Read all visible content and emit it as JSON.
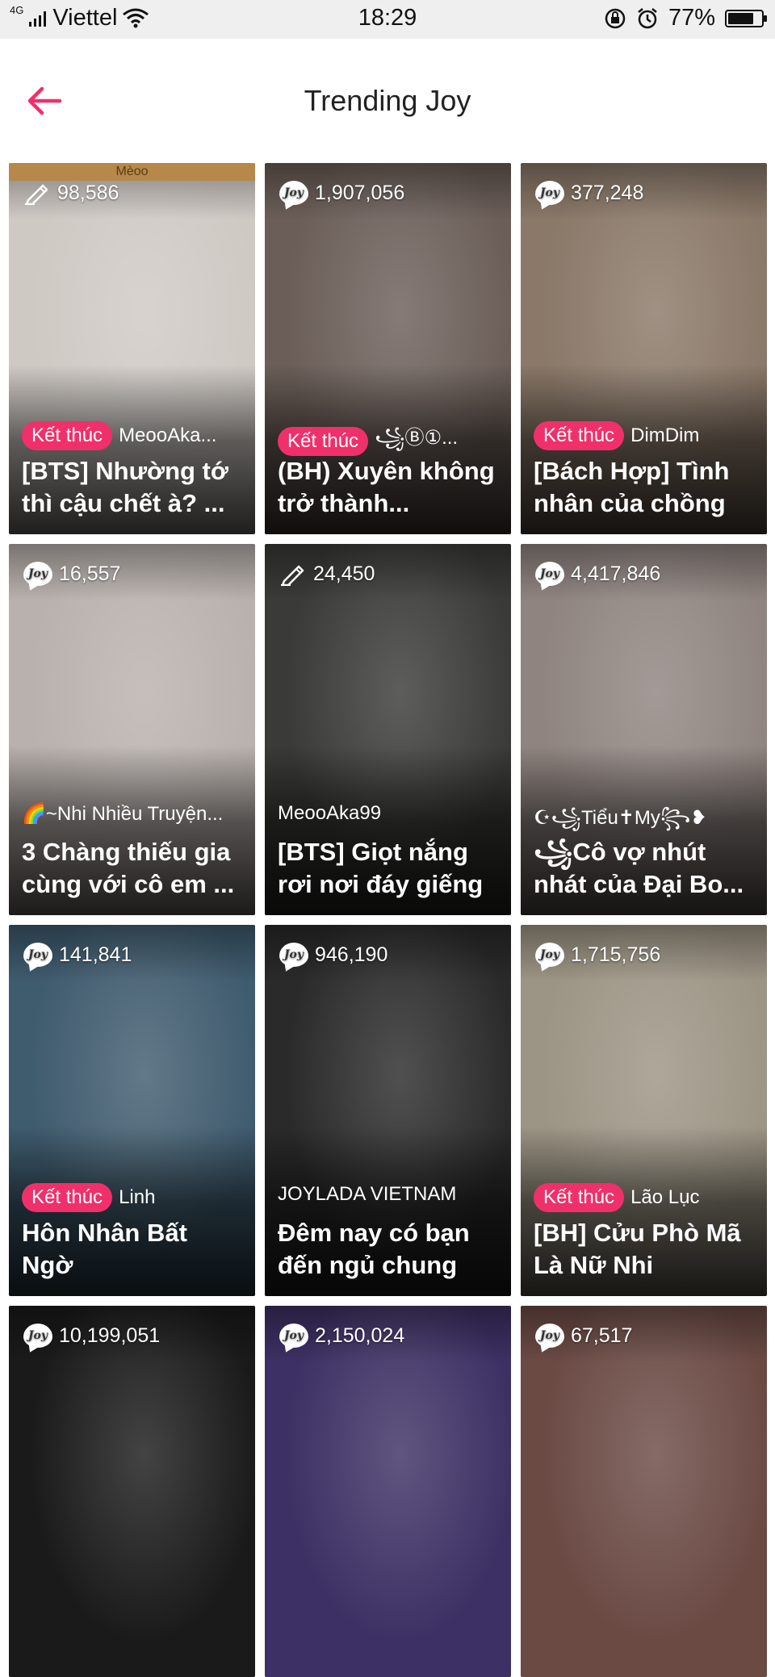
{
  "status_bar": {
    "network": "4G",
    "carrier": "Viettel",
    "time": "18:29",
    "battery": "77%",
    "battery_level": 0.77
  },
  "header": {
    "title": "Trending Joy"
  },
  "colors": {
    "accent": "#f0306a",
    "badge_bg": "#ffffff"
  },
  "cards": [
    {
      "count": "98,586",
      "icon": "pen-icon",
      "status": "Kết thúc",
      "author": "MeooAka...",
      "title": "[BTS] Nhường tớ thì cậu chết à? ...",
      "cover_text": "Mèoo",
      "cover": "#cfc9c4"
    },
    {
      "count": "1,907,056",
      "icon": "joy-icon",
      "status": "Kết thúc",
      "author": "꧁Ⓑ①...",
      "title": "(BH) Xuyên không trở thành...",
      "cover": "#6b5e58"
    },
    {
      "count": "377,248",
      "icon": "joy-icon",
      "status": "Kết thúc",
      "author": "DimDim",
      "title": "[Bách Hợp] Tình nhân của chồng",
      "cover": "#8a7868"
    },
    {
      "count": "16,557",
      "icon": "joy-icon",
      "status": "",
      "author": "🌈~Nhi Nhiều Truyện...",
      "title": "3 Chàng thiếu gia cùng với cô em ...",
      "cover": "#b9b1ad"
    },
    {
      "count": "24,450",
      "icon": "pen-icon",
      "status": "",
      "author": "MeooAka99",
      "title": "[BTS] Giọt nắng rơi nơi đáy giếng",
      "cover": "#3a3a38"
    },
    {
      "count": "4,417,846",
      "icon": "joy-icon",
      "status": "",
      "author": "☪꧁Tiểu✝My꧂❥",
      "title": "꧁Cô vợ nhút nhát của Đại Bo...",
      "cover": "#8f8480"
    },
    {
      "count": "141,841",
      "icon": "joy-icon",
      "status": "Kết thúc",
      "author": "Linh",
      "title": "Hôn Nhân Bất Ngờ",
      "cover": "#3f5b6e"
    },
    {
      "count": "946,190",
      "icon": "joy-icon",
      "status": "",
      "author": "JOYLADA VIETNAM",
      "title": "Đêm nay có bạn đến ngủ chung",
      "cover": "#2a2a2a"
    },
    {
      "count": "1,715,756",
      "icon": "joy-icon",
      "status": "Kết thúc",
      "author": "Lão Lục",
      "title": "[BH] Cửu Phò Mã Là Nữ Nhi",
      "cover": "#9c9484"
    },
    {
      "count": "10,199,051",
      "icon": "joy-icon",
      "status": "",
      "author": "",
      "title": "",
      "cover": "#1a1a1a"
    },
    {
      "count": "2,150,024",
      "icon": "joy-icon",
      "status": "",
      "author": "",
      "title": "",
      "cover": "#3d3064"
    },
    {
      "count": "67,517",
      "icon": "joy-icon",
      "status": "",
      "author": "",
      "title": "",
      "cover": "#6b4a44"
    }
  ]
}
